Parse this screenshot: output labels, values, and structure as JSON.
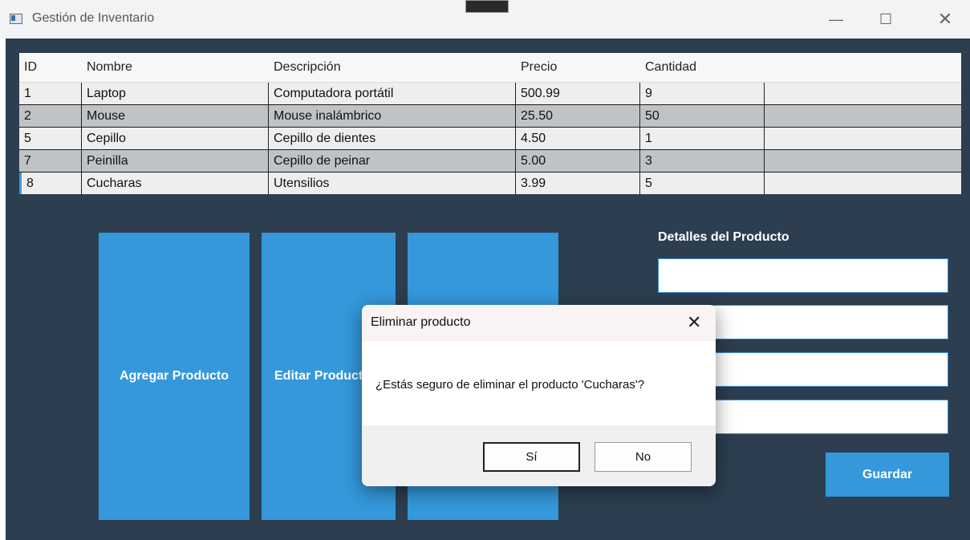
{
  "window": {
    "title": "Gestión de Inventario",
    "controls": {
      "minimize": "—",
      "maximize": "☐",
      "close": "✕"
    }
  },
  "table": {
    "columns": [
      "ID",
      "Nombre",
      "Descripción",
      "Precio",
      "Cantidad",
      ""
    ],
    "rows": [
      [
        "1",
        "Laptop",
        "Computadora portátil",
        "500.99",
        "9",
        ""
      ],
      [
        "2",
        "Mouse",
        "Mouse inalámbrico",
        "25.50",
        "50",
        ""
      ],
      [
        "5",
        "Cepillo",
        "Cepillo de dientes",
        "4.50",
        "1",
        ""
      ],
      [
        "7",
        "Peinilla",
        "Cepillo de peinar",
        "5.00",
        "3",
        ""
      ],
      [
        "8",
        "Cucharas",
        "Utensilios",
        "3.99",
        "5",
        ""
      ]
    ]
  },
  "actions": {
    "add_label": "Agregar Producto",
    "edit_label": "Editar Producto",
    "delete_label": ""
  },
  "details": {
    "title": "Detalles del Producto",
    "save_label": "Guardar"
  },
  "dialog": {
    "title": "Eliminar producto",
    "message": "¿Estás seguro de eliminar el producto 'Cucharas'?",
    "yes_label": "Sí",
    "no_label": "No",
    "close_glyph": "✕"
  },
  "colors": {
    "background": "#2c3e50",
    "accent": "#3498db"
  }
}
